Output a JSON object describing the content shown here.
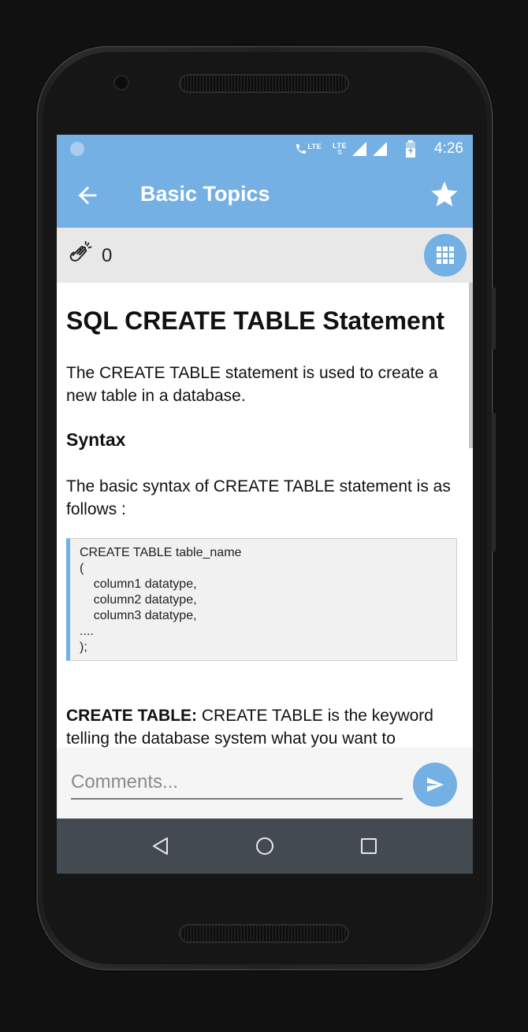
{
  "status_bar": {
    "network_labels": [
      "LTE",
      "LTE"
    ],
    "time": "4:26",
    "icons": [
      "notification-dot-icon",
      "call-lte-icon",
      "signal-lte-icon",
      "signal-icon",
      "signal-icon",
      "battery-icon"
    ]
  },
  "app_bar": {
    "title": "Basic Topics",
    "back_icon": "arrow-left-icon",
    "favorite_icon": "star-icon"
  },
  "sub_bar": {
    "clap_icon": "clap-icon",
    "clap_count": "0",
    "menu_icon": "grid-icon"
  },
  "article": {
    "title": "SQL CREATE TABLE Statement",
    "intro": "The CREATE TABLE statement is used to create a new table in a database.",
    "syntax_heading": "Syntax",
    "syntax_desc": "The basic syntax of CREATE TABLE statement is as follows :",
    "code_lines": [
      "CREATE TABLE table_name",
      "(",
      "    column1 datatype,",
      "    column2 datatype,",
      "    column3 datatype,",
      "....",
      ");"
    ],
    "keyword_label": "CREATE TABLE:",
    "keyword_desc": " CREATE TABLE is the keyword telling the database system what you want to"
  },
  "comment_bar": {
    "placeholder": "Comments...",
    "send_icon": "send-icon"
  },
  "nav_bar": {
    "items": [
      "back-triangle-icon",
      "home-circle-icon",
      "recents-square-icon"
    ]
  },
  "colors": {
    "accent": "#74b0e4",
    "nav_bar": "#434a52",
    "sub_bar": "#e8e8e8"
  }
}
